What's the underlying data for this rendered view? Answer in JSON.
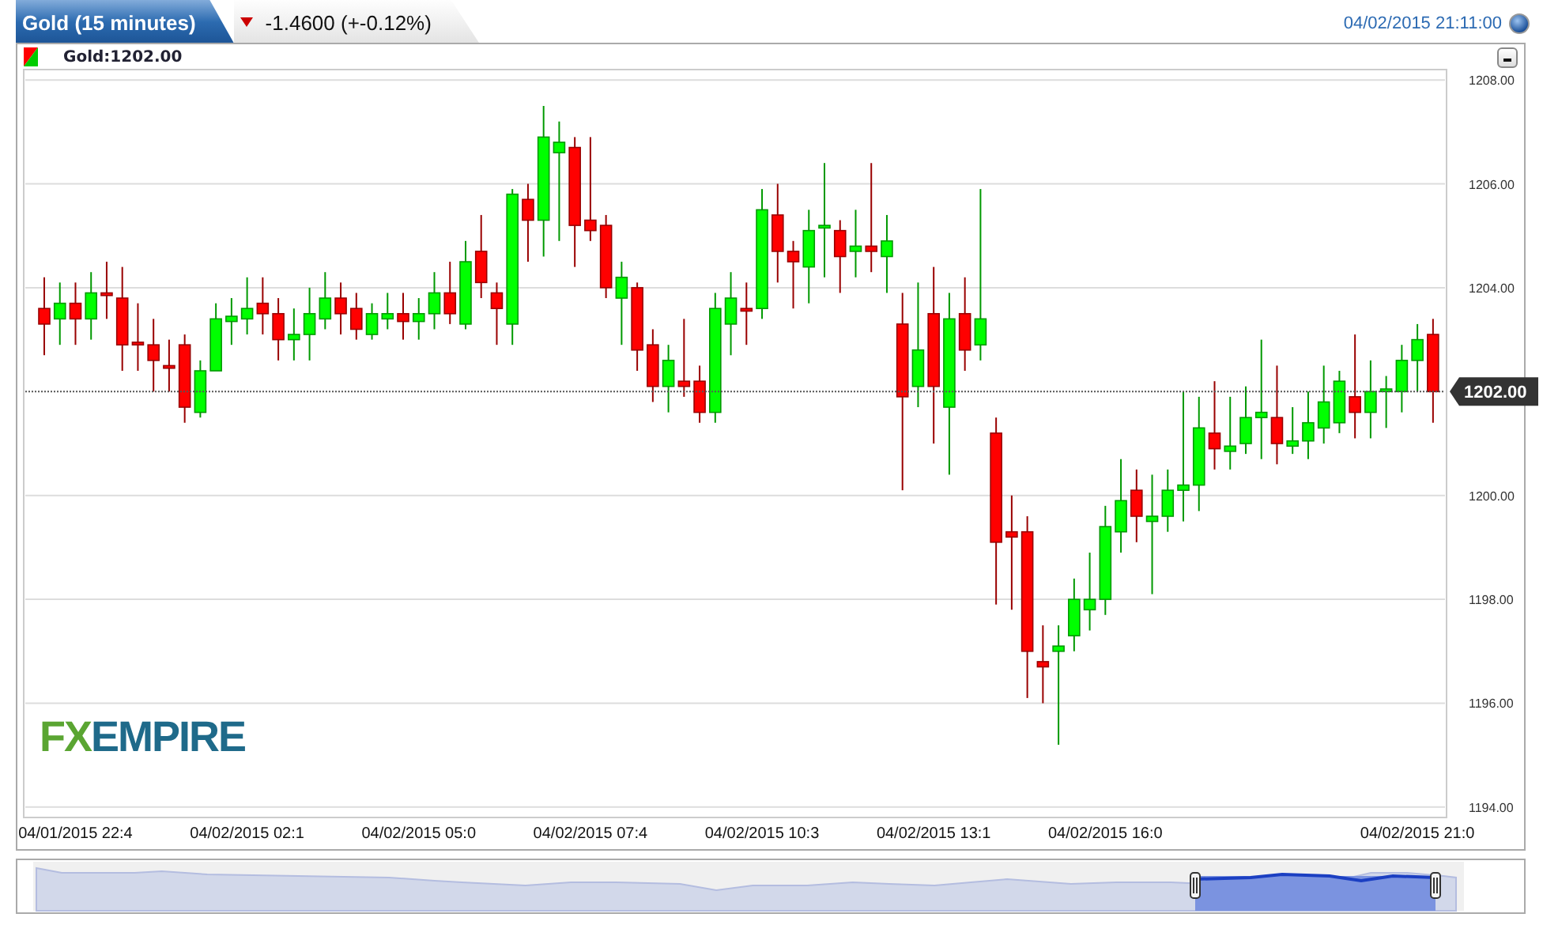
{
  "header": {
    "title": "Gold (15 minutes)",
    "change": "-1.4600 (+-0.12%)",
    "falling": true,
    "timestamp": "04/02/2015 21:11:00"
  },
  "legend": {
    "label": "Gold:1202.00"
  },
  "chart": {
    "chart_data": {
      "type": "candlestick",
      "ylim": [
        1193.8,
        1208.2
      ],
      "grid": true,
      "yticks": [
        {
          "value": 1208,
          "label": "1208.00"
        },
        {
          "value": 1206,
          "label": "1206.00"
        },
        {
          "value": 1204,
          "label": "1204.00"
        },
        {
          "value": 1200,
          "label": "1200.00"
        },
        {
          "value": 1198,
          "label": "1198.00"
        },
        {
          "value": 1196,
          "label": "1196.00"
        },
        {
          "value": 1194,
          "label": "1194.00"
        }
      ],
      "categories": [
        null,
        null,
        "04/01/2015 22:4",
        null,
        null,
        null,
        null,
        null,
        null,
        null,
        null,
        null,
        null,
        "04/02/2015 02:1",
        null,
        null,
        null,
        null,
        null,
        null,
        null,
        null,
        null,
        null,
        "04/02/2015 05:0",
        null,
        null,
        null,
        null,
        null,
        null,
        null,
        null,
        null,
        null,
        "04/02/2015 07:4",
        null,
        null,
        null,
        null,
        null,
        null,
        null,
        null,
        null,
        null,
        "04/02/2015 10:3",
        null,
        null,
        null,
        null,
        null,
        null,
        null,
        null,
        null,
        null,
        "04/02/2015 13:1",
        null,
        null,
        null,
        null,
        null,
        null,
        null,
        null,
        null,
        null,
        "04/02/2015 16:0",
        null,
        null,
        null,
        null,
        null,
        null,
        null,
        null,
        null,
        null,
        null,
        null,
        null,
        null,
        null,
        null,
        null,
        null,
        null,
        "04/02/2015 21:0",
        null
      ],
      "ref_lines": [
        {
          "axis": "y",
          "value": 1202.0
        }
      ],
      "ohlc": [
        [
          1203.6,
          1204.2,
          1202.7,
          1203.3
        ],
        [
          1203.4,
          1204.1,
          1202.9,
          1203.7
        ],
        [
          1203.7,
          1204.1,
          1202.9,
          1203.4
        ],
        [
          1203.4,
          1204.3,
          1203.0,
          1203.9
        ],
        [
          1203.9,
          1204.5,
          1203.4,
          1203.85
        ],
        [
          1203.8,
          1204.4,
          1202.4,
          1202.9
        ],
        [
          1202.95,
          1203.7,
          1202.4,
          1202.9
        ],
        [
          1202.9,
          1203.4,
          1202.0,
          1202.6
        ],
        [
          1202.5,
          1203.0,
          1202.0,
          1202.45
        ],
        [
          1202.9,
          1203.1,
          1201.4,
          1201.7
        ],
        [
          1201.6,
          1202.6,
          1201.5,
          1202.4
        ],
        [
          1202.4,
          1203.7,
          1202.4,
          1203.4
        ],
        [
          1203.35,
          1203.8,
          1202.9,
          1203.45
        ],
        [
          1203.4,
          1204.2,
          1203.1,
          1203.6
        ],
        [
          1203.7,
          1204.2,
          1203.1,
          1203.5
        ],
        [
          1203.5,
          1203.8,
          1202.6,
          1203.0
        ],
        [
          1203.0,
          1203.6,
          1202.6,
          1203.1
        ],
        [
          1203.1,
          1204.0,
          1202.6,
          1203.5
        ],
        [
          1203.4,
          1204.3,
          1203.2,
          1203.8
        ],
        [
          1203.8,
          1204.1,
          1203.1,
          1203.5
        ],
        [
          1203.6,
          1203.9,
          1203.0,
          1203.2
        ],
        [
          1203.1,
          1203.7,
          1203.0,
          1203.5
        ],
        [
          1203.4,
          1203.9,
          1203.2,
          1203.5
        ],
        [
          1203.5,
          1203.9,
          1203.0,
          1203.35
        ],
        [
          1203.35,
          1203.8,
          1203.0,
          1203.5
        ],
        [
          1203.5,
          1204.3,
          1203.2,
          1203.9
        ],
        [
          1203.9,
          1204.5,
          1203.3,
          1203.5
        ],
        [
          1203.3,
          1204.9,
          1203.2,
          1204.5
        ],
        [
          1204.7,
          1205.4,
          1203.8,
          1204.1
        ],
        [
          1203.9,
          1204.1,
          1202.9,
          1203.6
        ],
        [
          1203.3,
          1205.9,
          1202.9,
          1205.8
        ],
        [
          1205.7,
          1206.0,
          1204.5,
          1205.3
        ],
        [
          1205.3,
          1207.5,
          1204.6,
          1206.9
        ],
        [
          1206.6,
          1207.2,
          1204.9,
          1206.8
        ],
        [
          1206.7,
          1206.9,
          1204.4,
          1205.2
        ],
        [
          1205.3,
          1206.9,
          1204.9,
          1205.1
        ],
        [
          1205.2,
          1205.4,
          1203.8,
          1204.0
        ],
        [
          1203.8,
          1204.5,
          1202.9,
          1204.2
        ],
        [
          1204.0,
          1204.1,
          1202.4,
          1202.8
        ],
        [
          1202.9,
          1203.2,
          1201.8,
          1202.1
        ],
        [
          1202.1,
          1202.9,
          1201.6,
          1202.6
        ],
        [
          1202.2,
          1203.4,
          1201.9,
          1202.1
        ],
        [
          1202.2,
          1202.5,
          1201.4,
          1201.6
        ],
        [
          1201.6,
          1203.9,
          1201.4,
          1203.6
        ],
        [
          1203.3,
          1204.3,
          1202.7,
          1203.8
        ],
        [
          1203.6,
          1204.1,
          1202.9,
          1203.55
        ],
        [
          1203.6,
          1205.9,
          1203.4,
          1205.5
        ],
        [
          1205.4,
          1206.0,
          1204.1,
          1204.7
        ],
        [
          1204.7,
          1204.9,
          1203.6,
          1204.5
        ],
        [
          1204.4,
          1205.5,
          1203.7,
          1205.1
        ],
        [
          1205.15,
          1206.4,
          1204.2,
          1205.2
        ],
        [
          1205.1,
          1205.3,
          1203.9,
          1204.6
        ],
        [
          1204.7,
          1205.5,
          1204.2,
          1204.8
        ],
        [
          1204.8,
          1206.4,
          1204.3,
          1204.7
        ],
        [
          1204.6,
          1205.4,
          1203.9,
          1204.9
        ],
        [
          1203.3,
          1203.9,
          1200.1,
          1201.9
        ],
        [
          1202.1,
          1204.1,
          1201.7,
          1202.8
        ],
        [
          1203.5,
          1204.4,
          1201.0,
          1202.1
        ],
        [
          1201.7,
          1203.9,
          1200.4,
          1203.4
        ],
        [
          1203.5,
          1204.2,
          1202.4,
          1202.8
        ],
        [
          1202.9,
          1205.9,
          1202.6,
          1203.4
        ],
        [
          1201.2,
          1201.5,
          1197.9,
          1199.1
        ],
        [
          1199.3,
          1200.0,
          1197.8,
          1199.2
        ],
        [
          1199.3,
          1199.6,
          1196.1,
          1197.0
        ],
        [
          1196.8,
          1197.5,
          1196.0,
          1196.7
        ],
        [
          1197.0,
          1197.5,
          1195.2,
          1197.1
        ],
        [
          1197.3,
          1198.4,
          1197.0,
          1198.0
        ],
        [
          1197.8,
          1198.9,
          1197.4,
          1198.0
        ],
        [
          1198.0,
          1199.8,
          1197.7,
          1199.4
        ],
        [
          1199.3,
          1200.7,
          1198.9,
          1199.9
        ],
        [
          1200.1,
          1200.5,
          1199.1,
          1199.6
        ],
        [
          1199.5,
          1200.4,
          1198.1,
          1199.6
        ],
        [
          1199.6,
          1200.5,
          1199.3,
          1200.1
        ],
        [
          1200.1,
          1202.0,
          1199.5,
          1200.2
        ],
        [
          1200.2,
          1201.9,
          1199.7,
          1201.3
        ],
        [
          1201.2,
          1202.2,
          1200.5,
          1200.9
        ],
        [
          1200.85,
          1201.9,
          1200.5,
          1200.95
        ],
        [
          1201.0,
          1202.1,
          1200.8,
          1201.5
        ],
        [
          1201.5,
          1203.0,
          1200.7,
          1201.6
        ],
        [
          1201.5,
          1202.5,
          1200.6,
          1201.0
        ],
        [
          1200.95,
          1201.7,
          1200.8,
          1201.05
        ],
        [
          1201.05,
          1202.0,
          1200.7,
          1201.4
        ],
        [
          1201.3,
          1202.5,
          1201.0,
          1201.8
        ],
        [
          1201.4,
          1202.4,
          1201.2,
          1202.2
        ],
        [
          1201.9,
          1203.1,
          1201.1,
          1201.6
        ],
        [
          1201.6,
          1202.6,
          1201.1,
          1202.0
        ],
        [
          1202.0,
          1202.3,
          1201.3,
          1202.05
        ],
        [
          1202.0,
          1202.9,
          1201.6,
          1202.6
        ],
        [
          1202.6,
          1203.3,
          1202.0,
          1203.0
        ],
        [
          1203.1,
          1203.4,
          1201.4,
          1202.0
        ]
      ]
    },
    "last_price": "1202.00",
    "logo": [
      "FX",
      "EMPIRE"
    ]
  }
}
